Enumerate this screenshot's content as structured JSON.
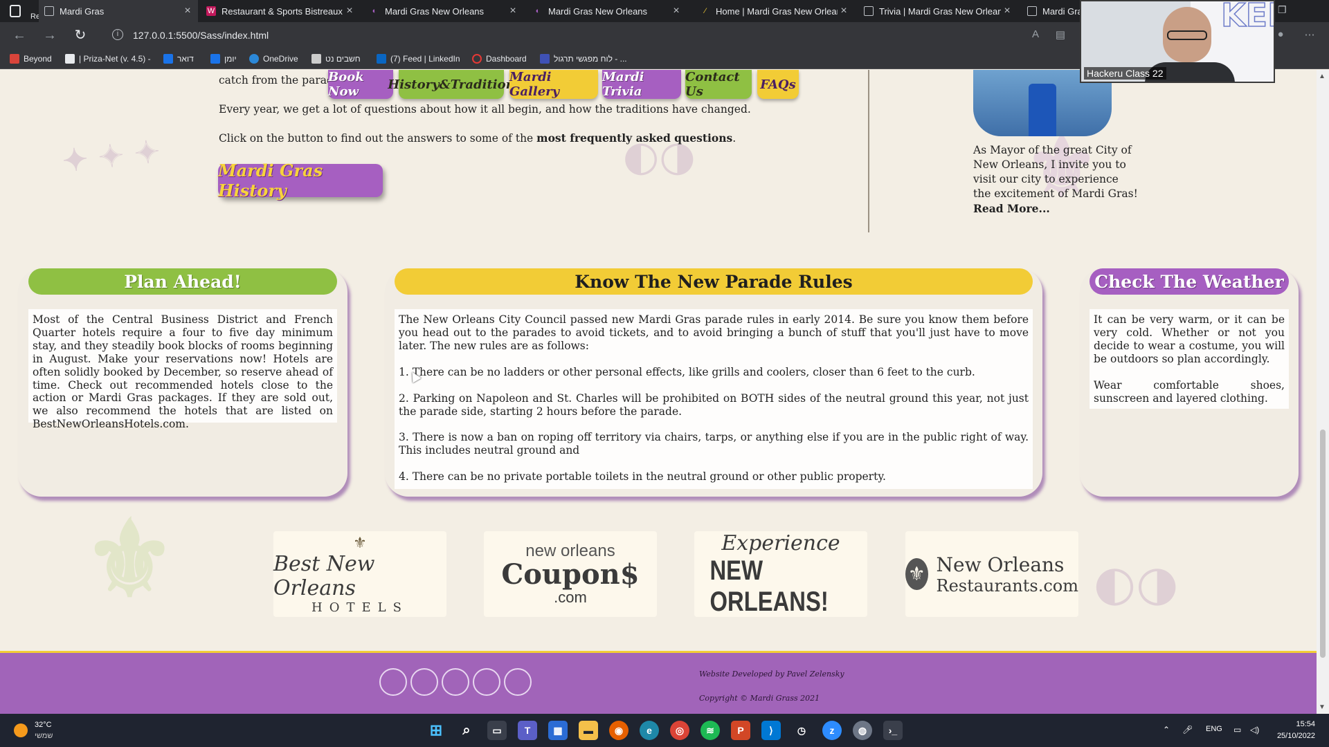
{
  "browser": {
    "recording_label": "Recording",
    "tabs": [
      {
        "title": "Mardi Gras",
        "icon": "page-icon"
      },
      {
        "title": "Restaurant & Sports Bistreaux | \\",
        "icon": "restaurant-icon"
      },
      {
        "title": "Mardi Gras New Orleans",
        "icon": "mask-icon"
      },
      {
        "title": "Mardi Gras New Orleans",
        "icon": "mask-icon"
      },
      {
        "title": "Home | Mardi Gras New Orleans",
        "icon": "feather-icon"
      },
      {
        "title": "Trivia | Mardi Gras New Orleans",
        "icon": "page-icon"
      },
      {
        "title": "Mardi Gras",
        "icon": "page-icon"
      }
    ],
    "url": "127.0.0.1:5500/Sass/index.html",
    "bookmarks": [
      {
        "label": "Beyond",
        "color": "#d9443a"
      },
      {
        "label": "| Priza-Net (v. 4.5) -",
        "color": "#e8eaed"
      },
      {
        "label": "דואר",
        "color": "#1a73e8"
      },
      {
        "label": "יומן",
        "color": "#1a73e8"
      },
      {
        "label": "OneDrive",
        "color": "#2b88d8"
      },
      {
        "label": "חשבים נט",
        "color": "#cccccc"
      },
      {
        "label": "(7) Feed | LinkedIn",
        "color": "#0a66c2"
      },
      {
        "label": "Dashboard",
        "color": "#e53935"
      },
      {
        "label": "לוח מפגשי תרגול - ...",
        "color": "#3f51b5"
      }
    ]
  },
  "site": {
    "nav": [
      "Book Now",
      "History&Tradition",
      "Mardi Gallery",
      "Mardi Trivia",
      "Contact Us",
      "FAQs"
    ],
    "intro_fragment": "catch from the parad",
    "intro_line1": "Every year, we get a lot of questions about how it all begin, and how the traditions have changed.",
    "intro_line2_prefix": "Click on the button to find out the answers to some of the ",
    "intro_line2_bold": "most frequently asked questions",
    "intro_line2_suffix": ".",
    "history_button": "Mardi Gras History",
    "mayor": {
      "text": "As Mayor of the great City of New Orleans, I invite you to visit our city to experience the excitement of Mardi Gras! ",
      "read_more": "Read More..."
    },
    "cards": {
      "plan": {
        "title": "Plan Ahead!",
        "body": "Most of the Central Business District and French Quarter hotels require a four to five day minimum stay, and they steadily book blocks of rooms beginning in August. Make your reservations now! Hotels are often solidly booked by December, so reserve ahead of time. Check out recommended hotels close to the action or Mardi Gras packages. If they are sold out, we also recommend the hotels that are listed on BestNewOrleansHotels.com."
      },
      "rules": {
        "title": "Know The New Parade Rules",
        "intro": "The New Orleans City Council passed new Mardi Gras parade rules in early 2014. Be sure you know them before you head out to the parades to avoid tickets, and to avoid bringing a bunch of stuff that you'll just have to move later. The new rules are as follows:",
        "rule1": "1. There can be no ladders or other personal effects, like grills and coolers, closer than 6 feet to the curb.",
        "rule2": "2. Parking on Napoleon and St. Charles will be prohibited on BOTH sides of the neutral ground this year, not just the parade side, starting 2 hours before the parade.",
        "rule3": "3. There is now a ban on roping off territory via chairs, tarps, or anything else if you are in the public right of way. This includes neutral ground and",
        "rule4": "4. There can be no private portable toilets in the neutral ground or other public property."
      },
      "weather": {
        "title": "Check The Weather",
        "p1": "It can be very warm, or it can be very cold. Whether or not you decide to wear a costume, you will be outdoors so plan accordingly.",
        "p2": "Wear comfortable shoes, sunscreen and layered clothing."
      }
    },
    "partners": [
      {
        "line1": "Best New Orleans",
        "line2": "HOTELS"
      },
      {
        "line1": "new orleans",
        "line2": "Coupon$",
        "line3": ".com"
      },
      {
        "line1": "Experience",
        "line2": "NEW ORLEANS!"
      },
      {
        "line1": "New Orleans",
        "line2": "Restaurants.com"
      }
    ],
    "footer": {
      "developer": "Website Developed by Pavel Zelensky",
      "copyright": "Copyright © Mardi Grass 2021"
    }
  },
  "webcam": {
    "label": "Hackeru Class 22"
  },
  "taskbar": {
    "temperature": "32°C",
    "condition": "שמשי",
    "language": "ENG",
    "time": "15:54",
    "date": "25/10/2022"
  },
  "colors": {
    "purple": "#a65fc1",
    "green": "#8fc043",
    "gold": "#f2cc36",
    "footer": "#a164b9"
  }
}
